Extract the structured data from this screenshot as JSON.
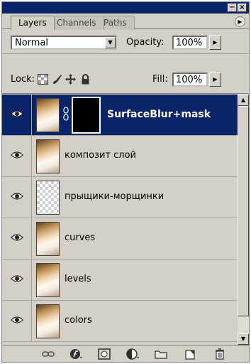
{
  "window": {
    "minimize_glyph": "−",
    "close_glyph": "×"
  },
  "tabs": [
    {
      "label": "Layers",
      "active": true
    },
    {
      "label": "Channels",
      "active": false
    },
    {
      "label": "Paths",
      "active": false
    }
  ],
  "panel_menu_glyph": "▶",
  "blend_mode": {
    "value": "Normal",
    "arrow": "▼"
  },
  "opacity": {
    "label": "Opacity:",
    "value": "100%",
    "arrow": "▶"
  },
  "lock": {
    "label": "Lock:"
  },
  "fill": {
    "label": "Fill:",
    "value": "100%",
    "arrow": "▶"
  },
  "layers": [
    {
      "name": "SurfaceBlur+mask",
      "selected": true,
      "thumb": "photo",
      "has_mask": true
    },
    {
      "name": "композит слой",
      "selected": false,
      "thumb": "photo",
      "has_mask": false
    },
    {
      "name": "прыщики-морщинки",
      "selected": false,
      "thumb": "transparent",
      "has_mask": false
    },
    {
      "name": "curves",
      "selected": false,
      "thumb": "photo",
      "has_mask": false
    },
    {
      "name": "levels",
      "selected": false,
      "thumb": "photo",
      "has_mask": false
    },
    {
      "name": "colors",
      "selected": false,
      "thumb": "photo",
      "has_mask": false
    }
  ],
  "scrollbar": {
    "up": "▲",
    "down": "▼"
  },
  "colors": {
    "selection": "#0a246a",
    "panel": "#d4d0c8"
  }
}
